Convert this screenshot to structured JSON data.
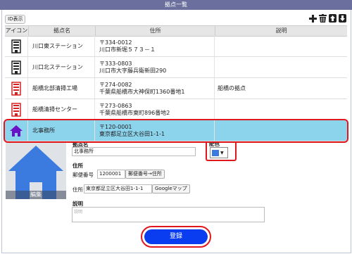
{
  "window": {
    "title": "拠点一覧"
  },
  "toolbar": {
    "id_toggle": "ID表示",
    "icons": [
      "plus-icon",
      "trash-icon",
      "move-up-icon",
      "move-down-icon"
    ]
  },
  "table": {
    "headers": [
      "アイコン",
      "拠点名",
      "住所",
      "説明"
    ],
    "rows": [
      {
        "icon": "building-icon",
        "color": "#222222",
        "name": "川口東ステーション",
        "zip": "〒334-0012",
        "address": "川口市新堀５７３－１",
        "desc": ""
      },
      {
        "icon": "building-icon",
        "color": "#222222",
        "name": "川口北ステーション",
        "zip": "〒333-0803",
        "address": "川口市大字藤兵衛新田290",
        "desc": ""
      },
      {
        "icon": "building-icon",
        "color": "#d62020",
        "name": "船橋北部清掃工場",
        "zip": "〒274-0082",
        "address": "千葉県船橋市大神保町1360番地1",
        "desc": "船橋の拠点"
      },
      {
        "icon": "building-icon",
        "color": "#d62020",
        "name": "船橋清掃センター",
        "zip": "〒273-0863",
        "address": "千葉県船橋市東町896番地2",
        "desc": ""
      },
      {
        "icon": "home-icon",
        "color": "#6a12c8",
        "name": "北事務所",
        "zip": "〒120-0001",
        "address": "東京都足立区大谷田1-1-1",
        "desc": ""
      }
    ]
  },
  "form": {
    "icon_edit_label": "編集",
    "name_label": "拠点名",
    "name_value": "北事務所",
    "color_label": "配色",
    "color_value": "#3b7be0",
    "address_label": "住所",
    "zip_label": "郵便番号",
    "zip_value": "1200001",
    "zip_to_address_button": "郵便番号→住所",
    "address_field_label": "住所",
    "address_value": "東京都足立区大谷田1-1-1",
    "google_map_button": "Googleマップ",
    "desc_label": "説明",
    "desc_placeholder": "説明",
    "submit_label": "登録"
  }
}
